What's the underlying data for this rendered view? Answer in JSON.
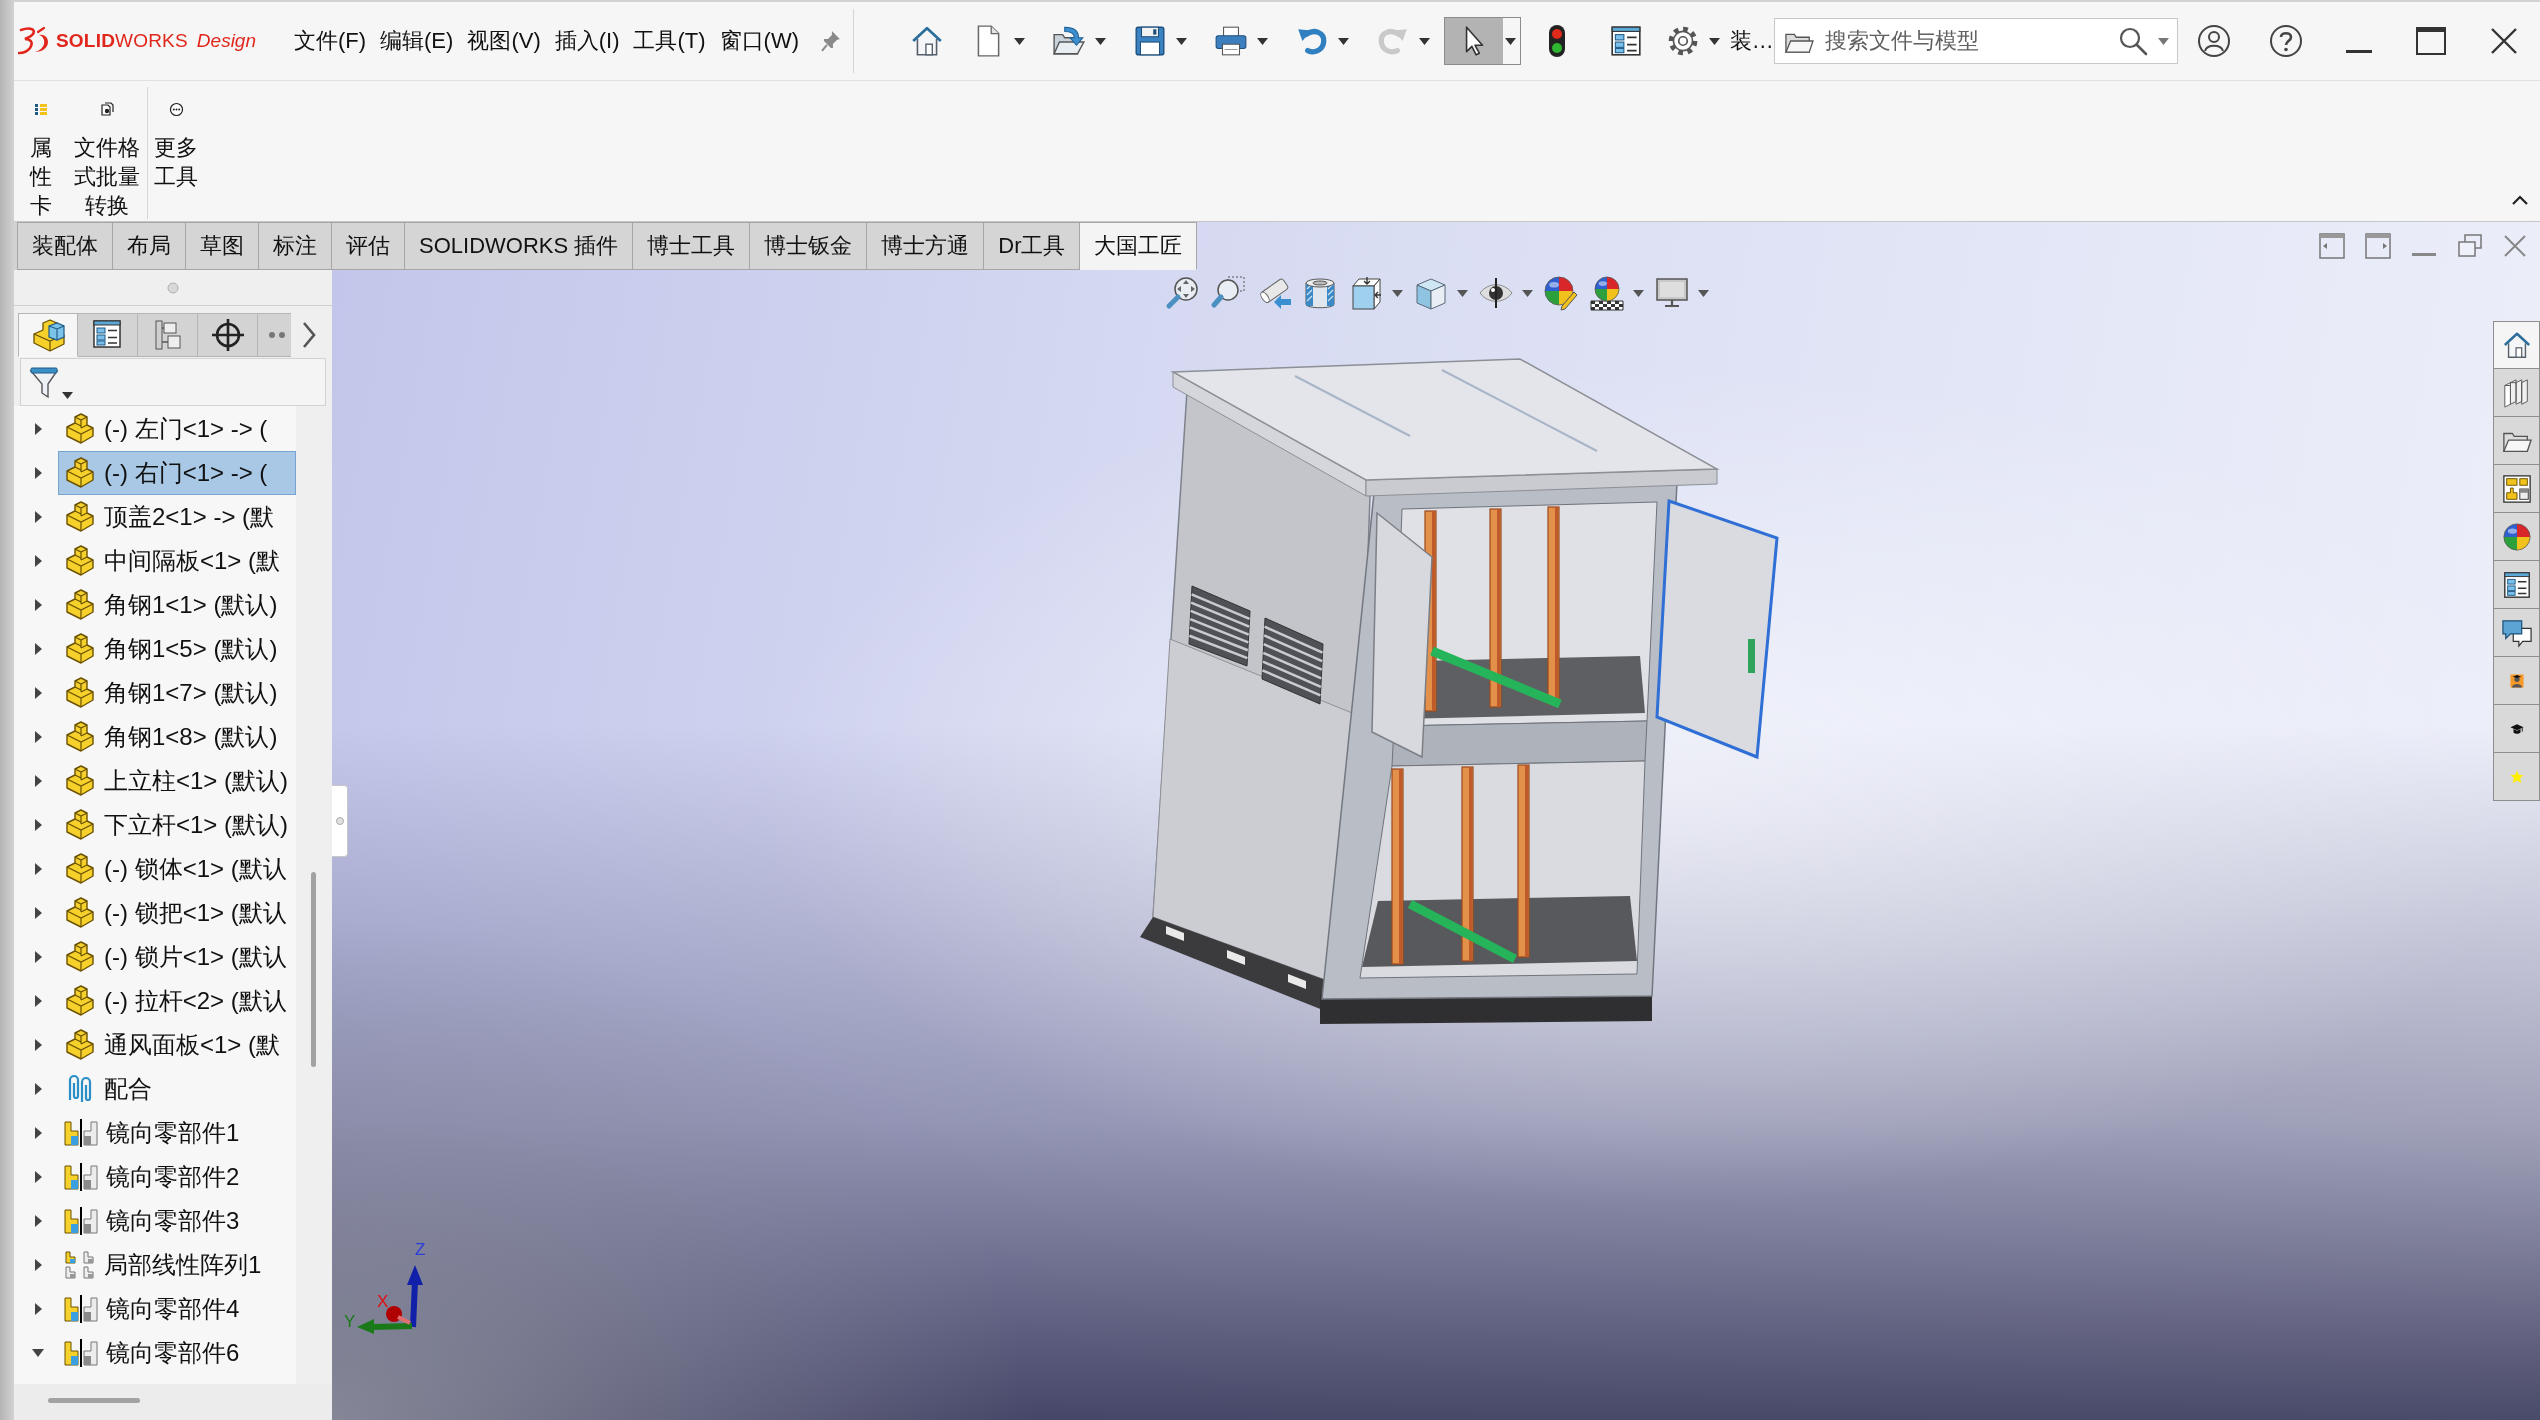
{
  "title_bar": {
    "logo": {
      "brand": "**SOLID**WORKS",
      "edition": "Design"
    },
    "menu": [
      {
        "label": "文件(F)"
      },
      {
        "label": "编辑(E)"
      },
      {
        "label": "视图(V)"
      },
      {
        "label": "插入(I)"
      },
      {
        "label": "工具(T)"
      },
      {
        "label": "窗口(W)"
      }
    ],
    "quick_access": [
      {
        "kind": "home",
        "dropdown": false,
        "disabled": false,
        "pressed": false
      },
      {
        "kind": "new",
        "dropdown": true,
        "disabled": false,
        "pressed": false
      },
      {
        "kind": "open",
        "dropdown": true,
        "disabled": false,
        "pressed": false
      },
      {
        "kind": "save",
        "dropdown": true,
        "disabled": false,
        "pressed": false
      },
      {
        "kind": "print",
        "dropdown": true,
        "disabled": false,
        "pressed": false
      },
      {
        "kind": "undo",
        "dropdown": true,
        "disabled": false,
        "pressed": false
      },
      {
        "kind": "redo",
        "dropdown": true,
        "disabled": true,
        "pressed": false
      },
      {
        "kind": "select",
        "dropdown": true,
        "disabled": false,
        "pressed": true
      },
      {
        "kind": "rebuild",
        "dropdown": false,
        "disabled": false,
        "pressed": false
      },
      {
        "kind": "file-properties",
        "dropdown": false,
        "disabled": false,
        "pressed": false
      },
      {
        "kind": "options",
        "dropdown": true,
        "disabled": false,
        "pressed": false
      }
    ],
    "truncated_command": "装…",
    "search": {
      "placeholder": "搜索文件与模型"
    }
  },
  "ribbon": {
    "buttons": [
      {
        "kind": "properties",
        "label": "属性卡"
      },
      {
        "kind": "batch-convert",
        "label": "文件格式批量转换"
      },
      {
        "kind": "more-tools",
        "label": "更多工具"
      }
    ]
  },
  "command_tabs": [
    {
      "label": "装配体",
      "selected": false
    },
    {
      "label": "布局",
      "selected": false
    },
    {
      "label": "草图",
      "selected": false
    },
    {
      "label": "标注",
      "selected": false
    },
    {
      "label": "评估",
      "selected": false
    },
    {
      "label": "SOLIDWORKS 插件",
      "selected": false
    },
    {
      "label": "博士工具",
      "selected": false
    },
    {
      "label": "博士钣金",
      "selected": false
    },
    {
      "label": "博士方通",
      "selected": false
    },
    {
      "label": "Dr工具",
      "selected": false
    },
    {
      "label": "大国工匠",
      "selected": true
    }
  ],
  "feature_manager": {
    "panel_tabs": [
      {
        "kind": "feature-tree",
        "selected": true
      },
      {
        "kind": "property-manager",
        "selected": false
      },
      {
        "kind": "configuration-manager",
        "selected": false
      },
      {
        "kind": "dim-xpert",
        "selected": false
      },
      {
        "kind": "more",
        "selected": false
      }
    ],
    "tree": [
      {
        "kind": "part",
        "label": "(-) 左门<1> -> (",
        "expanded": false,
        "selected": false
      },
      {
        "kind": "part",
        "label": "(-) 右门<1> -> (",
        "expanded": false,
        "selected": true
      },
      {
        "kind": "part",
        "label": "顶盖2<1> -> (默",
        "expanded": false,
        "selected": false
      },
      {
        "kind": "part",
        "label": "中间隔板<1> (默",
        "expanded": false,
        "selected": false
      },
      {
        "kind": "part",
        "label": "角钢1<1> (默认)",
        "expanded": false,
        "selected": false
      },
      {
        "kind": "part",
        "label": "角钢1<5> (默认)",
        "expanded": false,
        "selected": false
      },
      {
        "kind": "part",
        "label": "角钢1<7> (默认)",
        "expanded": false,
        "selected": false
      },
      {
        "kind": "part",
        "label": "角钢1<8> (默认)",
        "expanded": false,
        "selected": false
      },
      {
        "kind": "part",
        "label": "上立柱<1> (默认)",
        "expanded": false,
        "selected": false
      },
      {
        "kind": "part",
        "label": "下立杆<1> (默认)",
        "expanded": false,
        "selected": false
      },
      {
        "kind": "part",
        "label": "(-) 锁体<1> (默认",
        "expanded": false,
        "selected": false
      },
      {
        "kind": "part",
        "label": "(-) 锁把<1> (默认",
        "expanded": false,
        "selected": false
      },
      {
        "kind": "part",
        "label": "(-) 锁片<1> (默认",
        "expanded": false,
        "selected": false
      },
      {
        "kind": "part",
        "label": "(-) 拉杆<2> (默认",
        "expanded": false,
        "selected": false
      },
      {
        "kind": "part",
        "label": "通风面板<1> (默",
        "expanded": false,
        "selected": false
      },
      {
        "kind": "mates",
        "label": "配合",
        "expanded": false,
        "selected": false
      },
      {
        "kind": "mirror",
        "label": "镜向零部件1",
        "expanded": false,
        "selected": false
      },
      {
        "kind": "mirror",
        "label": "镜向零部件2",
        "expanded": false,
        "selected": false
      },
      {
        "kind": "mirror",
        "label": "镜向零部件3",
        "expanded": false,
        "selected": false
      },
      {
        "kind": "pattern",
        "label": "局部线性阵列1",
        "expanded": false,
        "selected": false
      },
      {
        "kind": "mirror",
        "label": "镜向零部件4",
        "expanded": false,
        "selected": false
      },
      {
        "kind": "mirror",
        "label": "镜向零部件6",
        "expanded": true,
        "selected": false
      }
    ]
  },
  "graphics_area": {
    "heads_up_toolbar": [
      {
        "kind": "zoom-to-fit",
        "dropdown": false
      },
      {
        "kind": "zoom-area",
        "dropdown": false
      },
      {
        "kind": "previous-view",
        "dropdown": false
      },
      {
        "kind": "section-view",
        "dropdown": false
      },
      {
        "kind": "view-orientation",
        "dropdown": true
      },
      {
        "kind": "display-style",
        "dropdown": true
      },
      {
        "kind": "hide-show",
        "dropdown": true
      },
      {
        "kind": "edit-appearance",
        "dropdown": false
      },
      {
        "kind": "apply-scene",
        "dropdown": true
      },
      {
        "kind": "view-settings",
        "dropdown": true
      }
    ],
    "triad": {
      "z_label": "Z",
      "x_label": "X",
      "y_label": "Y"
    },
    "task_pane": [
      {
        "kind": "home",
        "selected": true
      },
      {
        "kind": "library",
        "selected": false
      },
      {
        "kind": "file-explorer",
        "selected": false
      },
      {
        "kind": "view-palette",
        "selected": false
      },
      {
        "kind": "appearances",
        "selected": false
      },
      {
        "kind": "custom-properties",
        "selected": false
      },
      {
        "kind": "forum",
        "selected": false
      },
      {
        "kind": "person",
        "selected": false
      },
      {
        "kind": "learning",
        "selected": false
      },
      {
        "kind": "favorite",
        "selected": false
      }
    ]
  }
}
